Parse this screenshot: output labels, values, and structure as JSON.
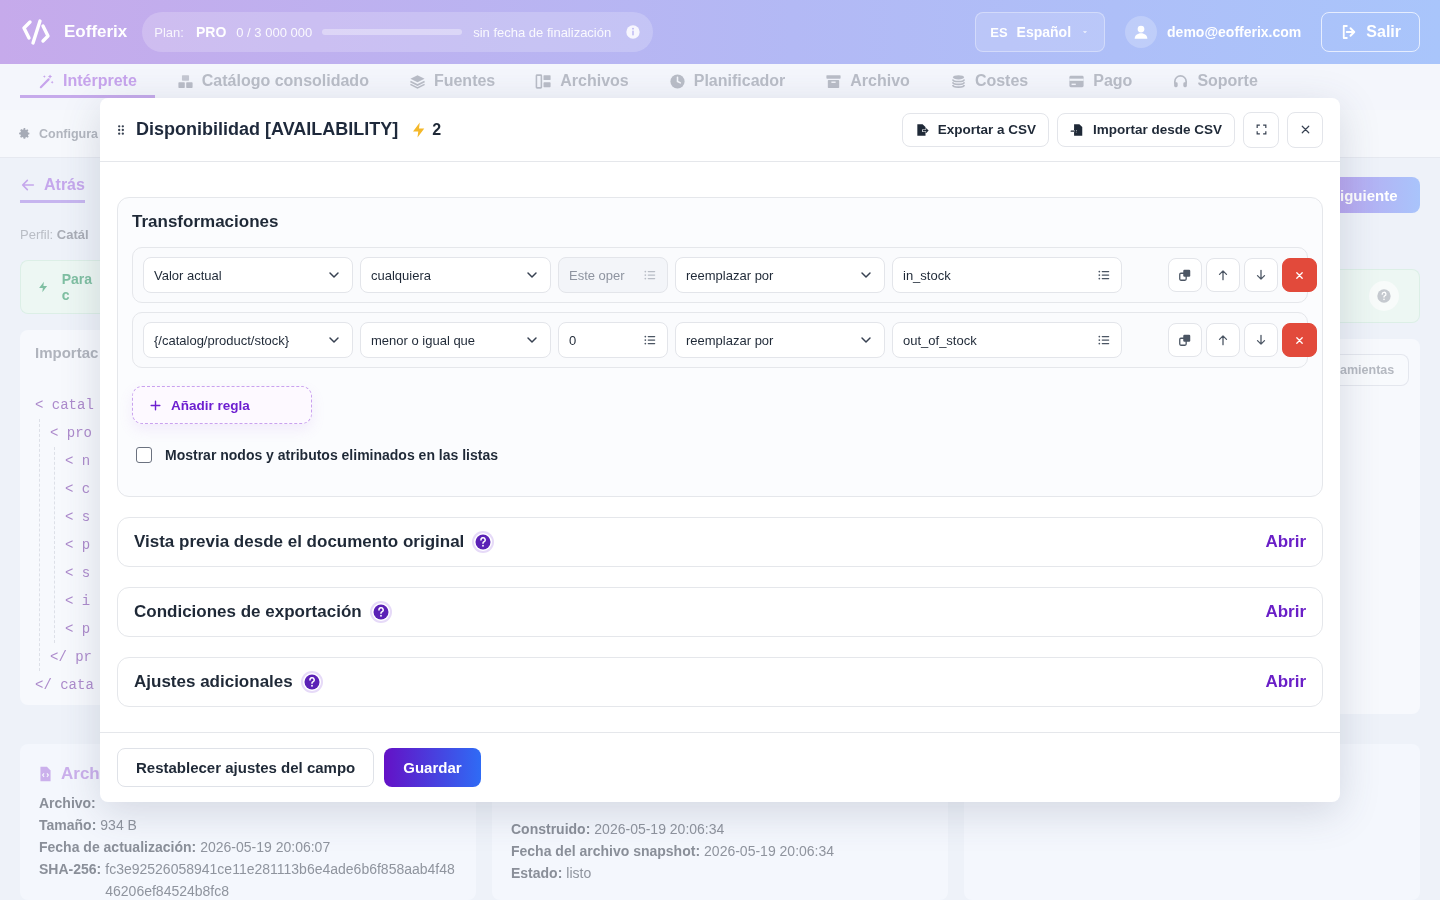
{
  "header": {
    "brand": "Eofferix",
    "plan": {
      "label": "Plan:",
      "name": "PRO",
      "usage": "0 / 3 000 000",
      "level": 0,
      "expiry": "sin fecha de finalización"
    },
    "language": {
      "code": "ES",
      "name": "Español"
    },
    "user": {
      "email": "demo@eofferix.com"
    },
    "logout": "Salir"
  },
  "nav": [
    {
      "label": "Intérprete",
      "selected": true
    },
    {
      "label": "Catálogo consolidado",
      "selected": false
    },
    {
      "label": "Fuentes",
      "selected": false
    },
    {
      "label": "Archivos",
      "selected": false
    },
    {
      "label": "Planificador",
      "selected": false
    },
    {
      "label": "Archivo",
      "selected": false
    },
    {
      "label": "Costes",
      "selected": false
    },
    {
      "label": "Pago",
      "selected": false
    },
    {
      "label": "Soporte",
      "selected": false
    }
  ],
  "page": {
    "breadcrumb": "Configura",
    "back": "Atrás",
    "profile": {
      "label": "Perfil:",
      "value": "Catál"
    },
    "hint": "Para c",
    "next_button": "iguiente",
    "import_card": {
      "title": "Importac",
      "tools_button": "amientas",
      "xml": [
        {
          "open": "< catal",
          "close": "</ cata",
          "children": [
            {
              "open": "< pro",
              "close": "</ pr",
              "children": [
                {
                  "open": "< n"
                },
                {
                  "open": "< c"
                },
                {
                  "open": "< s"
                },
                {
                  "open": "< p"
                },
                {
                  "open": "< s"
                },
                {
                  "open": "< i"
                },
                {
                  "open": "< p"
                }
              ]
            }
          ]
        }
      ]
    },
    "file_cards": [
      {
        "title": "Arch",
        "fields": [
          {
            "label": "Archivo:"
          },
          {
            "label": "Tamaño:",
            "value": "934 B"
          },
          {
            "label": "Fecha de actualización:",
            "value": "2026-05-19 20:06:07"
          },
          {
            "label": "SHA-256:",
            "value": "fc3e92526058941ce11e281113b6e4ade6b6f858aab4f4846206ef84524b8fc8"
          }
        ]
      },
      {
        "fields": [
          {
            "label": "Construido:",
            "value": "2026-05-19 20:06:34"
          },
          {
            "label": "Fecha del archivo snapshot:",
            "value": "2026-05-19 20:06:34"
          },
          {
            "label": "Estado:",
            "value": "listo"
          }
        ]
      }
    ]
  },
  "modal": {
    "title": "Disponibilidad [AVAILABILITY]",
    "count": "2",
    "buttons": [
      "Exportar a CSV",
      "Importar desde CSV"
    ],
    "transformations": {
      "title": "Transformaciones",
      "rules": [
        {
          "source": "Valor actual",
          "operator": "cualquiera",
          "operand": {
            "placeholder": "Este oper",
            "disabled": true
          },
          "action": "reemplazar por",
          "result": "in_stock"
        },
        {
          "source": "{/catalog/product/stock}",
          "operator": "menor o igual que",
          "operand": {
            "value": "0",
            "disabled": false
          },
          "action": "reemplazar por",
          "result": "out_of_stock"
        }
      ],
      "add_rule": "Añadir regla",
      "show_deleted": {
        "label": "Mostrar nodos y atributos eliminados en las listas",
        "checked": false
      }
    },
    "sections": [
      {
        "title": "Vista previa desde el documento original",
        "action": "Abrir"
      },
      {
        "title": "Condiciones de exportación",
        "action": "Abrir"
      },
      {
        "title": "Ajustes adicionales",
        "action": "Abrir"
      }
    ],
    "footer": {
      "reset": "Restablecer ajustes del campo",
      "save": "Guardar"
    }
  }
}
